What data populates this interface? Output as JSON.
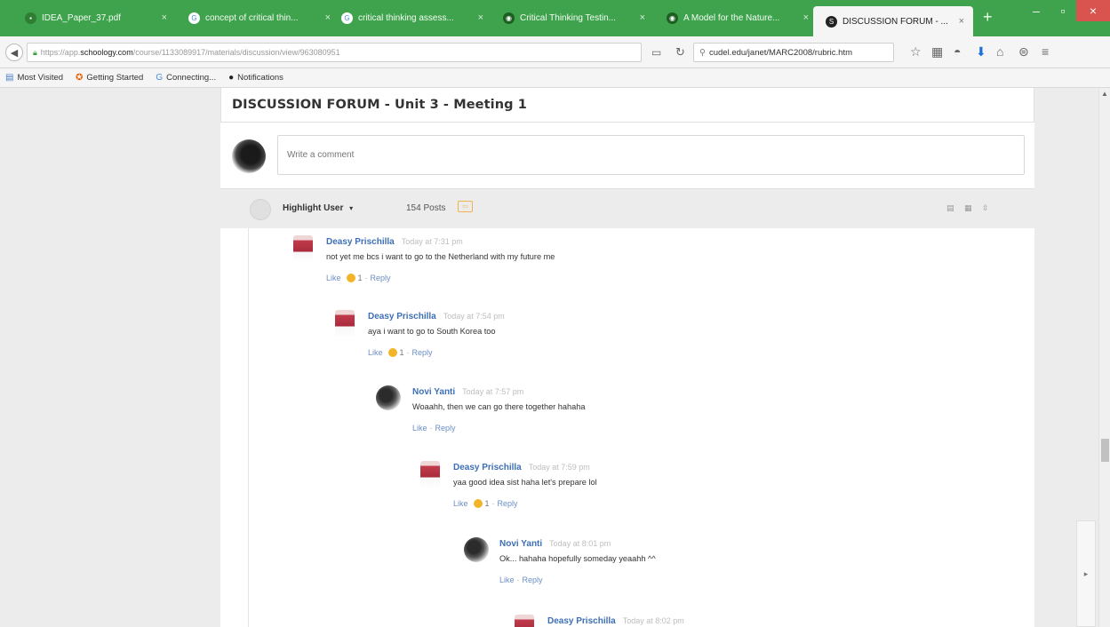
{
  "browser": {
    "tabs": [
      {
        "title": "IDEA_Paper_37.pdf",
        "icon": "pdf-icon",
        "color": "#3fa34d"
      },
      {
        "title": "concept of critical thin...",
        "icon": "google-icon",
        "color": "#4a90e2"
      },
      {
        "title": "critical thinking assess...",
        "icon": "google-icon",
        "color": "#4a90e2"
      },
      {
        "title": "Critical Thinking Testin...",
        "icon": "site-icon",
        "color": "#2e7d32"
      },
      {
        "title": "A Model for the Nature...",
        "icon": "site-icon",
        "color": "#2e7d32"
      },
      {
        "title": "DISCUSSION FORUM - ...",
        "icon": "schoology-icon",
        "color": "#222222"
      }
    ],
    "url_prefix": "https://app.",
    "url_domain": "schoology.com",
    "url_rest": "/course/1133089917/materials/discussion/view/963080951",
    "search_text": "cudel.edu/janet/MARC2008/rubric.htm"
  },
  "bookmarks": [
    {
      "label": "Most Visited",
      "icon": "folder-icon"
    },
    {
      "label": "Getting Started",
      "icon": "firefox-icon"
    },
    {
      "label": "Connecting...",
      "icon": "google-icon"
    },
    {
      "label": "Notifications",
      "icon": "schoology-icon"
    }
  ],
  "page": {
    "title": "DISCUSSION FORUM - Unit 3 - Meeting 1",
    "comment_placeholder": "Write a comment",
    "highlight_user": "Highlight User",
    "posts_count": "154 Posts"
  },
  "posts": [
    {
      "author": "Deasy Prischilla",
      "time": "Today at 7:31 pm",
      "text": "not yet me bcs i want to go to the Netherland with my future me",
      "like": "Like",
      "likes": "1",
      "reply": "Reply",
      "avatar": "deasy"
    },
    {
      "author": "Deasy Prischilla",
      "time": "Today at 7:54 pm",
      "text": "aya i want to go to South Korea too",
      "like": "Like",
      "likes": "1",
      "reply": "Reply",
      "avatar": "deasy"
    },
    {
      "author": "Novi Yanti",
      "time": "Today at 7:57 pm",
      "text": "Woaahh, then we can go there together hahaha",
      "like": "Like",
      "likes": "",
      "reply": "Reply",
      "avatar": "novi"
    },
    {
      "author": "Deasy Prischilla",
      "time": "Today at 7:59 pm",
      "text": "yaa good idea sist haha let's prepare lol",
      "like": "Like",
      "likes": "1",
      "reply": "Reply",
      "avatar": "deasy"
    },
    {
      "author": "Novi Yanti",
      "time": "Today at 8:01 pm",
      "text": "Ok... hahaha hopefully someday yeaahh ^^",
      "like": "Like",
      "likes": "",
      "reply": "Reply",
      "avatar": "novi"
    },
    {
      "author": "Deasy Prischilla",
      "time": "Today at 8:02 pm",
      "text": "",
      "like": "",
      "likes": "",
      "reply": "",
      "avatar": "deasy"
    }
  ]
}
